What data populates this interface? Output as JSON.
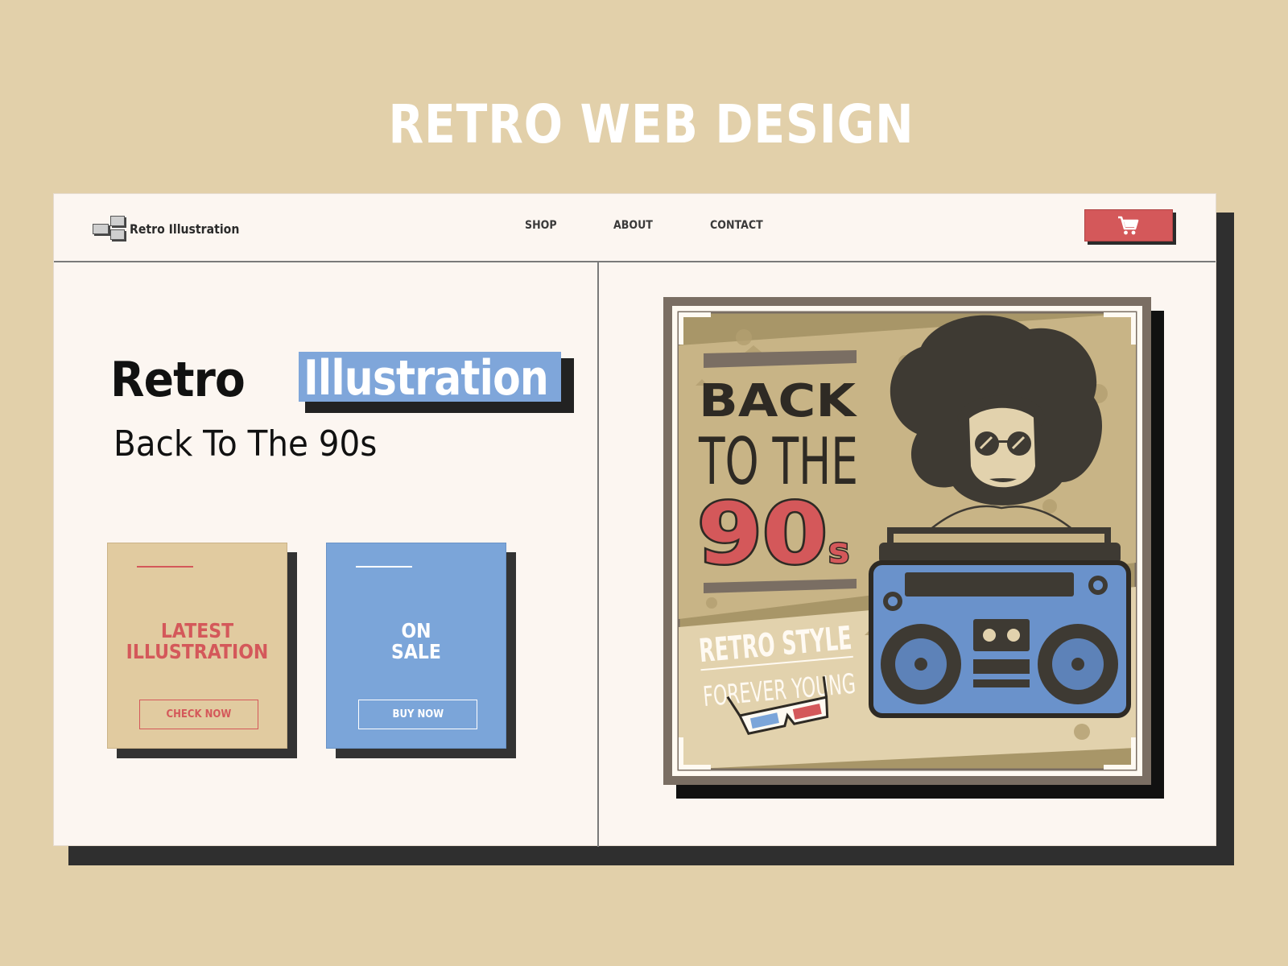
{
  "page": {
    "title": "RETRO WEB DESIGN"
  },
  "header": {
    "logo_text": "Retro Illustration",
    "nav": [
      {
        "label": "SHOP"
      },
      {
        "label": "ABOUT"
      },
      {
        "label": "CONTACT"
      }
    ],
    "cart_icon": "shopping-cart-icon"
  },
  "hero": {
    "title_word1": "Retro",
    "title_word2": "Illustration",
    "subtitle": "Back To The 90s"
  },
  "cards": [
    {
      "title_line1": "LATEST",
      "title_line2": "ILLUSTRATION",
      "button": "CHECK NOW"
    },
    {
      "title_line1": "ON",
      "title_line2": "SALE",
      "button": "BUY NOW"
    }
  ],
  "poster": {
    "line1": "BACK",
    "line2": "TO THE",
    "line3": "90",
    "line3_suffix": "s",
    "line4": "RETRO STYLE",
    "line5": "FOREVER YOUNG"
  },
  "colors": {
    "background": "#e2d0aa",
    "accent_red": "#d4585a",
    "accent_blue": "#7ba5d9",
    "panel": "#fcf6f1"
  }
}
